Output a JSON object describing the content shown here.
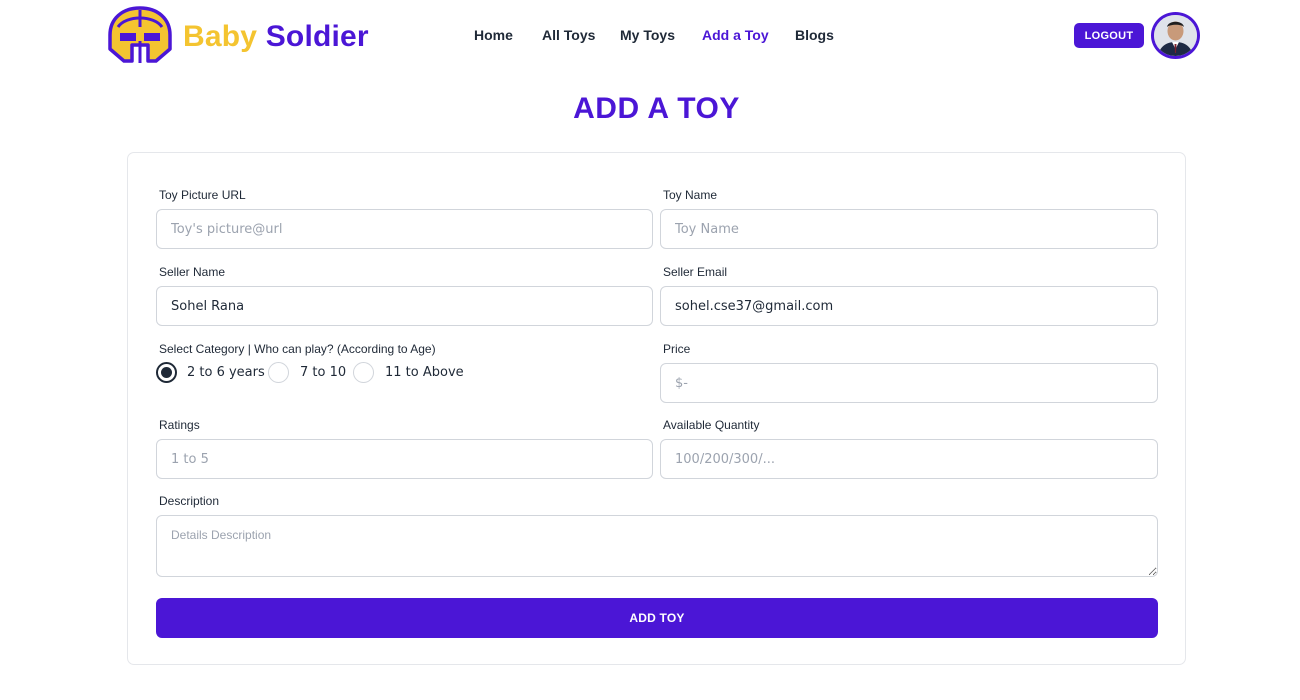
{
  "brand": {
    "part1": "Baby",
    "part2": "Soldier"
  },
  "nav": {
    "items": [
      {
        "label": "Home"
      },
      {
        "label": "All Toys"
      },
      {
        "label": "My Toys"
      },
      {
        "label": "Add a Toy",
        "active": true
      },
      {
        "label": "Blogs"
      }
    ],
    "logout_label": "LOGOUT"
  },
  "page": {
    "title": "ADD A TOY"
  },
  "form": {
    "toy_picture": {
      "label": "Toy Picture URL",
      "placeholder": "Toy's picture@url",
      "value": ""
    },
    "toy_name": {
      "label": "Toy Name",
      "placeholder": "Toy Name",
      "value": ""
    },
    "seller_name": {
      "label": "Seller Name",
      "value": "Sohel Rana"
    },
    "seller_email": {
      "label": "Seller Email",
      "value": "sohel.cse37@gmail.com"
    },
    "category": {
      "label": "Select Category | Who can play? (According to Age)",
      "options": [
        {
          "label": "2 to 6 years",
          "checked": true
        },
        {
          "label": "7 to 10",
          "checked": false
        },
        {
          "label": "11 to Above",
          "checked": false
        }
      ]
    },
    "price": {
      "label": "Price",
      "placeholder": "$-",
      "value": ""
    },
    "ratings": {
      "label": "Ratings",
      "placeholder": "1 to 5",
      "value": ""
    },
    "quantity": {
      "label": "Available Quantity",
      "placeholder": "100/200/300/...",
      "value": ""
    },
    "description": {
      "label": "Description",
      "placeholder": "Details Description",
      "value": ""
    },
    "submit_label": "ADD TOY"
  },
  "colors": {
    "accent": "#4b16d6",
    "brand_yellow": "#f4c430"
  },
  "icons": {
    "logo": "helmet-logo-icon",
    "avatar": "user-avatar"
  }
}
